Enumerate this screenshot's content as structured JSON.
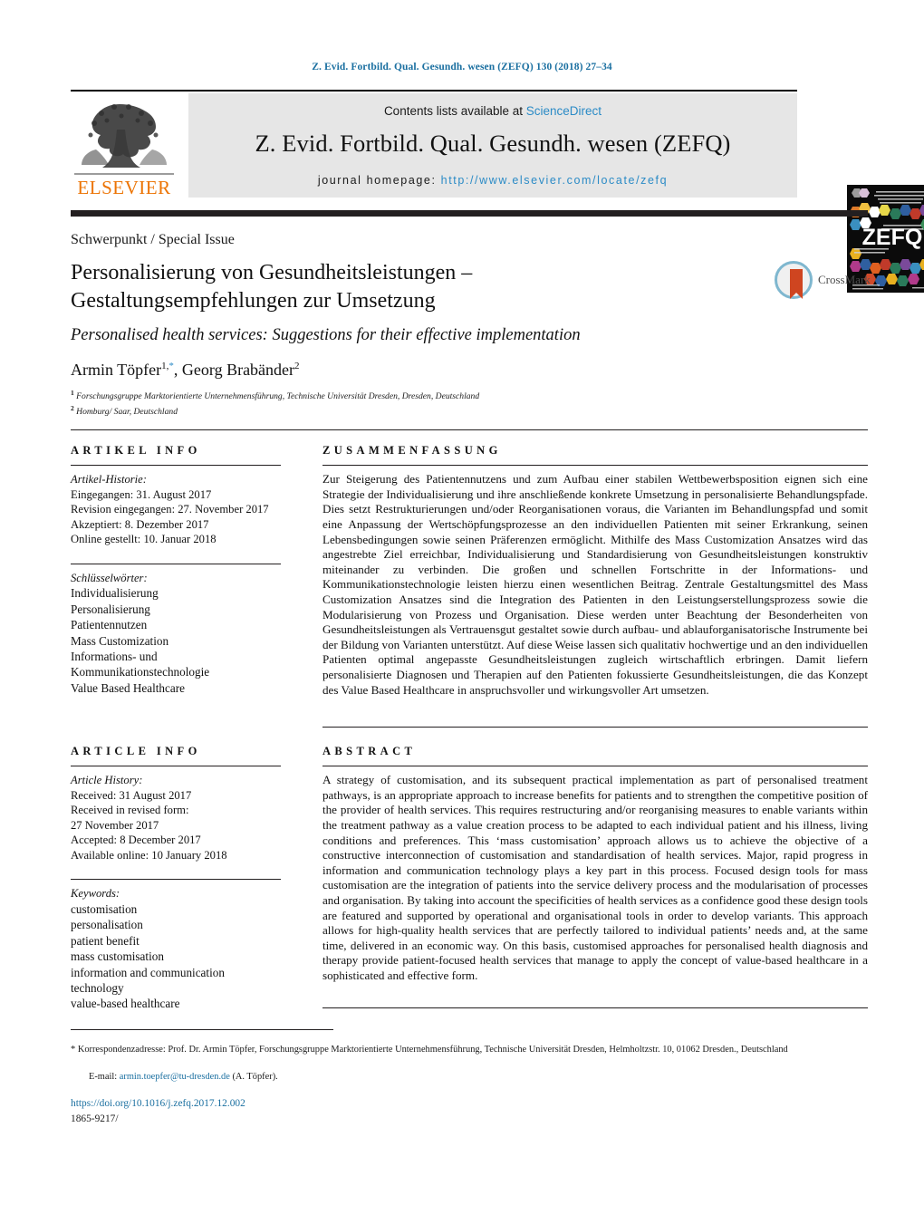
{
  "running_head": "Z. Evid. Fortbild. Qual. Gesundh. wesen (ZEFQ) 130 (2018) 27–34",
  "masthead": {
    "contents_prefix": "Contents lists available at ",
    "contents_link": "ScienceDirect",
    "journal_title": "Z. Evid. Fortbild. Qual. Gesundh. wesen (ZEFQ)",
    "homepage_prefix": "journal homepage: ",
    "homepage_link": "http://www.elsevier.com/locate/zefq",
    "publisher": "ELSEVIER",
    "cover_title": "ZEFQ"
  },
  "title_block": {
    "section_label": "Schwerpunkt / Special Issue",
    "title_line1": "Personalisierung von Gesundheitsleistungen –",
    "title_line2": "Gestaltungsempfehlungen zur Umsetzung",
    "subtitle": "Personalised health services: Suggestions for their effective implementation",
    "author1": "Armin Töpfer",
    "author1_sup": "1,",
    "author1_star": "*",
    "author_sep": ", ",
    "author2": "Georg Brabänder",
    "author2_sup": "2",
    "affiliation1_sup": "1",
    "affiliation1": "Forschungsgruppe Marktorientierte Unternehmensführung, Technische Universität Dresden, Dresden, Deutschland",
    "affiliation2_sup": "2",
    "affiliation2": "Homburg/ Saar, Deutschland",
    "crossmark_label": "CrossMark"
  },
  "artikel_info": {
    "heading": "ARTIKEL INFO",
    "history_label": "Artikel-Historie:",
    "history": [
      "Eingegangen: 31. August 2017",
      "Revision eingegangen: 27. November 2017",
      "Akzeptiert: 8. Dezember 2017",
      "Online gestellt: 10. Januar 2018"
    ],
    "keywords_label": "Schlüsselwörter:",
    "keywords": [
      "Individualisierung",
      "Personalisierung",
      "Patientennutzen",
      "Mass Customization",
      "Informations- und",
      "Kommunikationstechnologie",
      "Value Based Healthcare"
    ]
  },
  "article_info": {
    "heading": "ARTICLE INFO",
    "history_label": "Article History:",
    "history": [
      "Received: 31 August 2017",
      "Received in revised form:",
      "27 November 2017",
      "Accepted: 8 December 2017",
      "Available online: 10 January 2018"
    ],
    "keywords_label": "Keywords:",
    "keywords": [
      "customisation",
      "personalisation",
      "patient benefit",
      "mass customisation",
      "information and communication",
      "technology",
      "value-based healthcare"
    ]
  },
  "zusammenfassung": {
    "heading": "ZUSAMMENFASSUNG",
    "text": "Zur Steigerung des Patientennutzens und zum Aufbau einer stabilen Wettbewerbsposition eignen sich eine Strategie der Individualisierung und ihre anschließende konkrete Umsetzung in personalisierte Behandlungspfade. Dies setzt Restrukturierungen und/oder Reorganisationen voraus, die Varianten im Behandlungspfad und somit eine Anpassung der Wertschöpfungsprozesse an den individuellen Patienten mit seiner Erkrankung, seinen Lebensbedingungen sowie seinen Präferenzen ermöglicht. Mithilfe des Mass Customization Ansatzes wird das angestrebte Ziel erreichbar, Individualisierung und Standardisierung von Gesundheitsleistungen konstruktiv miteinander zu verbinden. Die großen und schnellen Fortschritte in der Informations- und Kommunikationstechnologie leisten hierzu einen wesentlichen Beitrag. Zentrale Gestaltungsmittel des Mass Customization Ansatzes sind die Integration des Patienten in den Leistungserstellungsprozess sowie die Modularisierung von Prozess und Organisation. Diese werden unter Beachtung der Besonderheiten von Gesundheitsleistungen als Vertrauensgut gestaltet sowie durch aufbau- und ablauforganisatorische Instrumente bei der Bildung von Varianten unterstützt. Auf diese Weise lassen sich qualitativ hochwertige und an den individuellen Patienten optimal angepasste Gesundheitsleistungen zugleich wirtschaftlich erbringen. Damit liefern personalisierte Diagnosen und Therapien auf den Patienten fokussierte Gesundheitsleistungen, die das Konzept des Value Based Healthcare in anspruchsvoller und wirkungsvoller Art umsetzen."
  },
  "abstract": {
    "heading": "ABSTRACT",
    "text": "A strategy of customisation, and its subsequent practical implementation as part of personalised treatment pathways, is an appropriate approach to increase benefits for patients and to strengthen the competitive position of the provider of health services. This requires restructuring and/or reorganising measures to enable variants within the treatment pathway as a value creation process to be adapted to each individual patient and his illness, living conditions and preferences. This ‘mass customisation’ approach allows us to achieve the objective of a constructive interconnection of customisation and standardisation of health services. Major, rapid progress in information and communication technology plays a key part in this process. Focused design tools for mass customisation are the integration of patients into the service delivery process and the modularisation of processes and organisation. By taking into account the specificities of health services as a confidence good these design tools are featured and supported by operational and organisational tools in order to develop variants. This approach allows for high-quality health services that are perfectly tailored to individual patients’ needs and, at the same time, delivered in an economic way. On this basis, customised approaches for personalised health diagnosis and therapy provide patient-focused health services that manage to apply the concept of value-based healthcare in a sophisticated and effective form."
  },
  "footer": {
    "corresponding_star": "*",
    "corresponding_text": "Korrespondenzadresse: Prof. Dr. Armin Töpfer, Forschungsgruppe Marktorientierte Unternehmensführung, Technische Universität Dresden, Helmholtzstr. 10, 01062 Dresden., Deutschland",
    "email_label": "E-mail: ",
    "email": "armin.toepfer@tu-dresden.de",
    "email_suffix": " (A. Töpfer).",
    "doi": "https://doi.org/10.1016/j.zefq.2017.12.002",
    "issn": "1865-9217/"
  },
  "colors": {
    "link_blue": "#2b8bc6",
    "running_head_blue": "#1a6fa0",
    "elsevier_orange": "#ec7404",
    "band_gray": "#e6e6e6",
    "bar_black": "#231f20"
  }
}
